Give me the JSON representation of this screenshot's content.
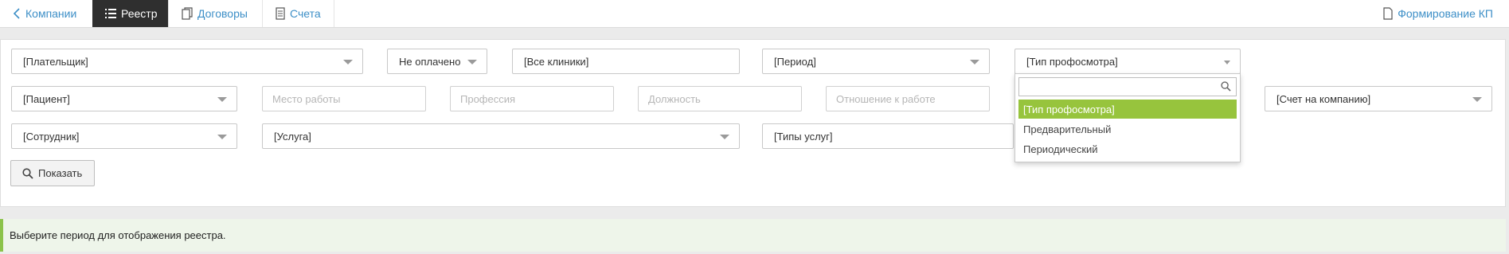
{
  "nav": {
    "back_label": "Компании",
    "registry_label": "Реестр",
    "contracts_label": "Договоры",
    "invoices_label": "Счета",
    "kp_label": "Формирование КП"
  },
  "filters": {
    "payer": "[Плательщик]",
    "payment_status": "Не оплачено",
    "clinics": "[Все клиники]",
    "period": "[Период]",
    "checkup_type": "[Тип профосмотра]",
    "patient": "[Пациент]",
    "workplace_placeholder": "Место работы",
    "profession_placeholder": "Профессия",
    "position_placeholder": "Должность",
    "work_relation_placeholder": "Отношение к работе",
    "company_invoice": "[Счет на компанию]",
    "employee": "[Сотрудник]",
    "service": "[Услуга]",
    "service_types": "[Типы услуг]"
  },
  "show_button": "Показать",
  "dropdown": {
    "search_value": "",
    "options": [
      "[Тип профосмотра]",
      "Предварительный",
      "Периодический"
    ],
    "selected_index": 0
  },
  "info_message": "Выберите период для отображения реестра.",
  "colors": {
    "link": "#3d8fc7",
    "active_tab_bg": "#2f2f2f",
    "selected_option": "#97c43d",
    "info_accent": "#8bc34a"
  }
}
